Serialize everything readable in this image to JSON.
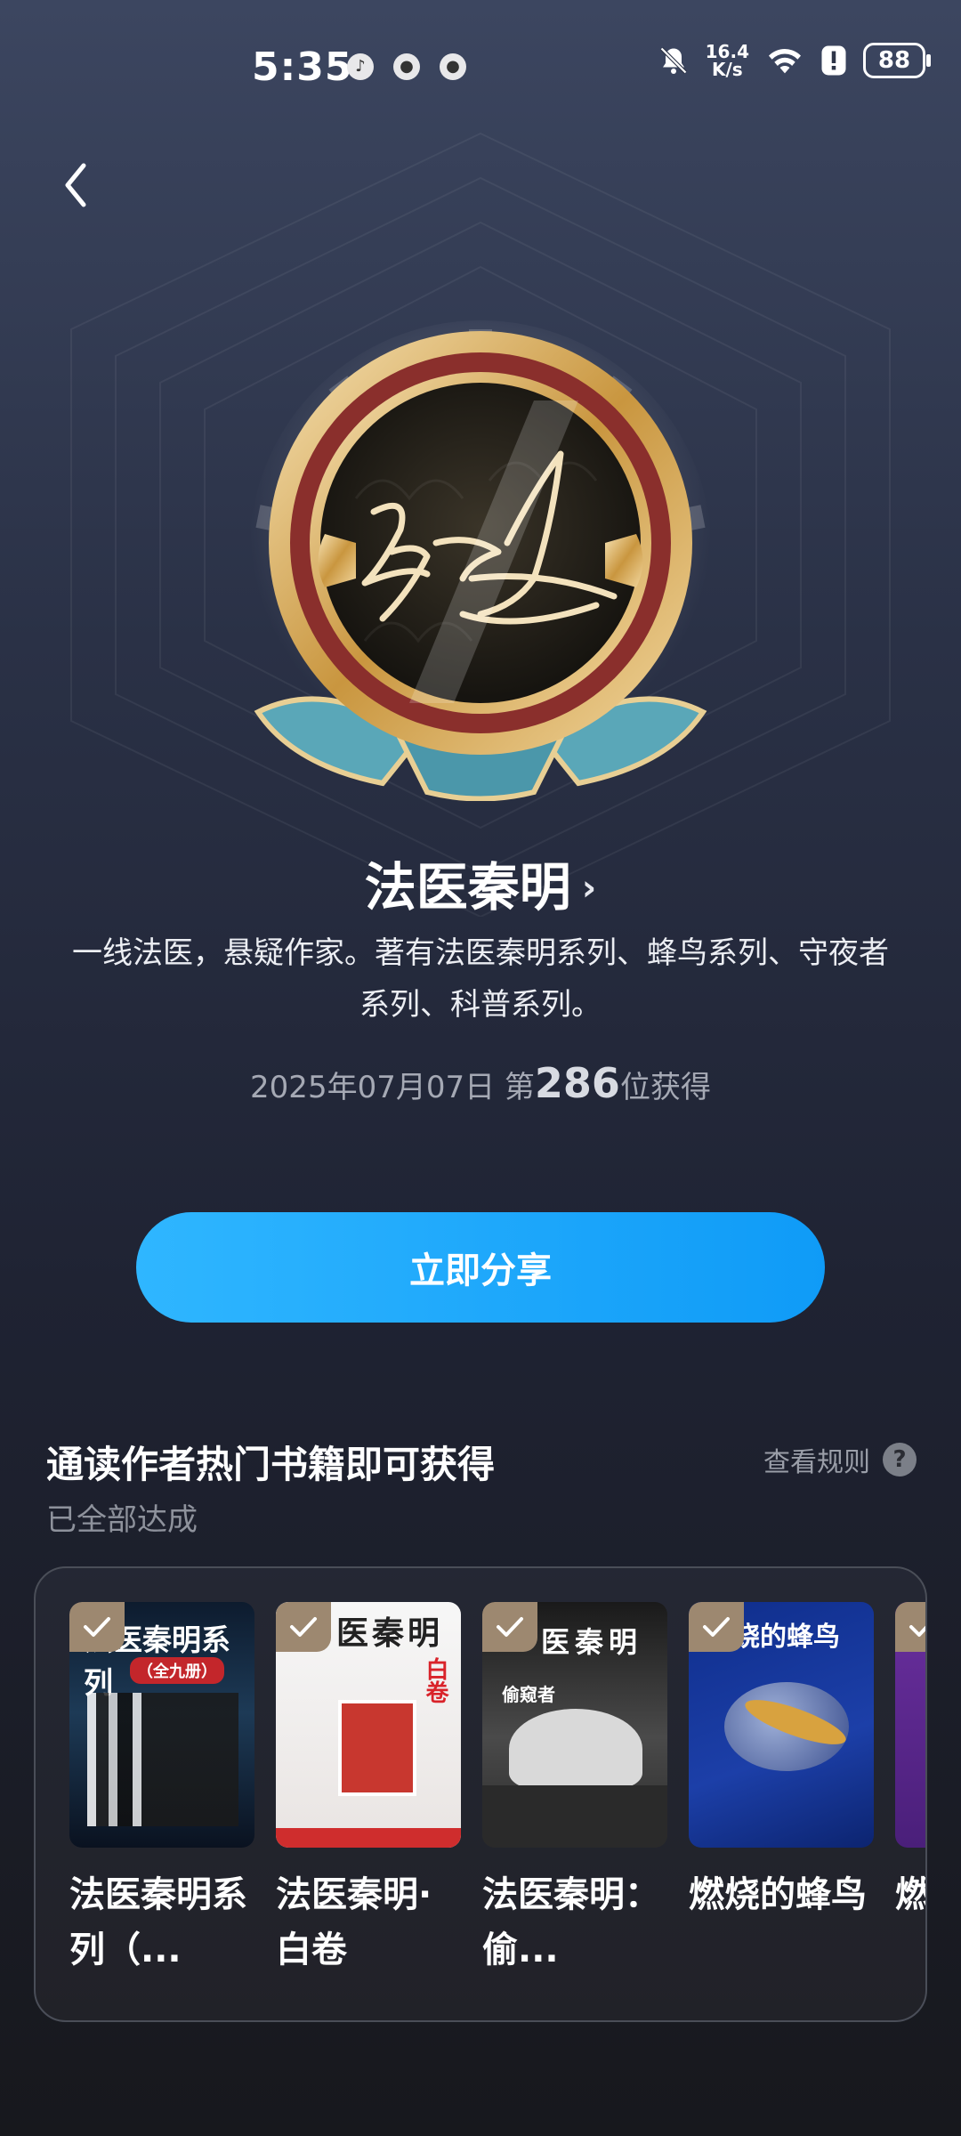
{
  "status_bar": {
    "time": "5:35",
    "net_speed_value": "16.4",
    "net_speed_unit": "K/s",
    "battery": "88"
  },
  "author": {
    "name": "法医秦明",
    "bio": "一线法医，悬疑作家。著有法医秦明系列、蜂鸟系列、守夜者系列、科普系列。",
    "date": "2025年07月07日",
    "rank_prefix": "第",
    "rank": "286",
    "rank_suffix": "位获得"
  },
  "share_button": "立即分享",
  "section": {
    "title": "通读作者热门书籍即可获得",
    "subtitle": "已全部达成",
    "rules_label": "查看规则"
  },
  "books": [
    {
      "title": "法医秦明系列（...",
      "cover_text": "法医秦明系列",
      "cover_sub": "（全九册）"
    },
    {
      "title": "法医秦明·白卷",
      "cover_text": "医秦明",
      "cover_sub": "白卷"
    },
    {
      "title": "法医秦明：偷...",
      "cover_text": "医秦明",
      "cover_sub": "偷窥者"
    },
    {
      "title": "燃烧的蜂鸟",
      "cover_text": "烧的蜂鸟",
      "cover_sub": ""
    },
    {
      "title": "燃烧的蜂鸟",
      "cover_text": "",
      "cover_sub": ""
    }
  ]
}
